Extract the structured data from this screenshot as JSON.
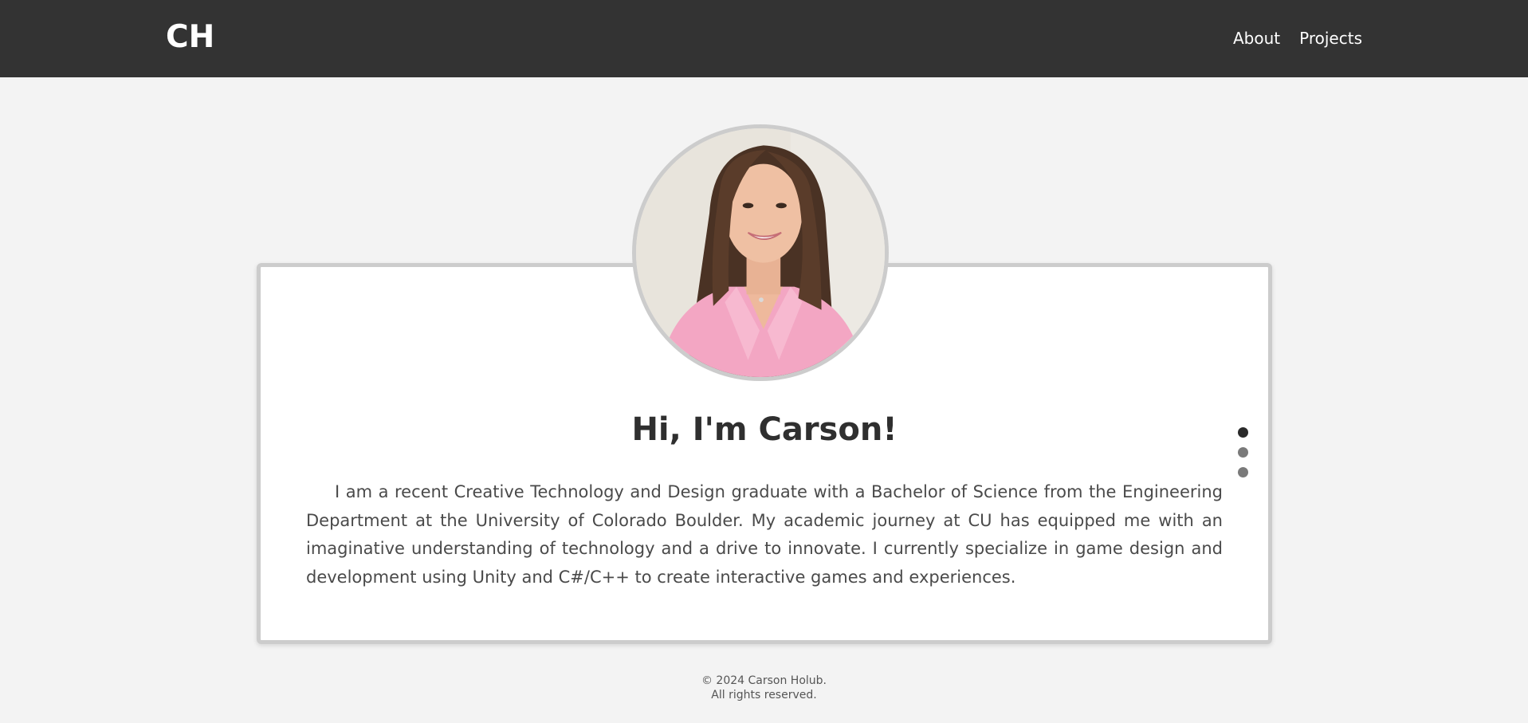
{
  "header": {
    "logo": "CH",
    "nav": [
      {
        "label": "About"
      },
      {
        "label": "Projects"
      }
    ]
  },
  "profile": {
    "heading": "Hi, I'm Carson!",
    "bio": "I am a recent Creative Technology and Design graduate with a Bachelor of Science from the Engineering Department at the University of Colorado Boulder. My academic journey at CU has equipped me with an imaginative understanding of technology and a drive to innovate. I currently specialize in game design and development using Unity and C#/C++ to create interactive games and experiences.",
    "carousel": {
      "slide_count": 3,
      "active_index": 0
    }
  },
  "footer": {
    "line1": "© 2024 Carson Holub.",
    "line2": "All rights reserved."
  },
  "colors": {
    "navbar": "#333333",
    "background": "#f3f3f3",
    "card": "#ffffff",
    "card_border": "#cccccc",
    "text_dark": "#2f2f2f",
    "text_body": "#4a4a4a",
    "dot_active": "#2a2a2a",
    "dot_inactive": "#7a7a7a"
  }
}
